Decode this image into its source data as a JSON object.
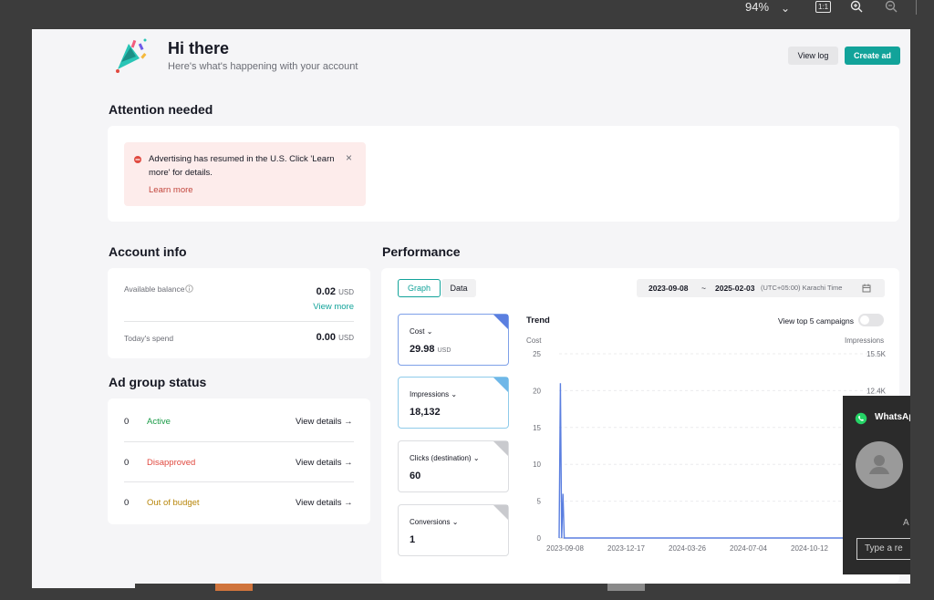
{
  "viewer": {
    "zoom": "94%",
    "icons": [
      "chevron-down-icon",
      "actual-size-icon",
      "zoom-in-icon",
      "zoom-out-icon"
    ],
    "actual_size_label": "1:1"
  },
  "header": {
    "title": "Hi there",
    "subtitle": "Here's what's happening with your account",
    "view_log": "View log",
    "create_ad": "Create ad"
  },
  "attention": {
    "heading": "Attention needed",
    "message": "Advertising has resumed in the U.S. Click 'Learn more' for details.",
    "link": "Learn more"
  },
  "account": {
    "heading": "Account info",
    "balance_label": "Available balance",
    "balance_value": "0.02",
    "balance_unit": "USD",
    "view_more": "View more",
    "spend_label": "Today's spend",
    "spend_value": "0.00",
    "spend_unit": "USD"
  },
  "ad_group": {
    "heading": "Ad group status",
    "rows": [
      {
        "count": "0",
        "status": "Active",
        "action": "View details",
        "color": "#1a9b47"
      },
      {
        "count": "0",
        "status": "Disapproved",
        "action": "View details",
        "color": "#e0493f"
      },
      {
        "count": "0",
        "status": "Out of budget",
        "action": "View details",
        "color": "#b8860b"
      }
    ]
  },
  "performance": {
    "heading": "Performance",
    "tabs": [
      "Graph",
      "Data"
    ],
    "date_start": "2023-09-08",
    "date_sep": "~",
    "date_end": "2025-02-03",
    "timezone": "(UTC+05:00) Karachi Time",
    "trend_label": "Trend",
    "top5_label": "View top 5 campaigns",
    "metrics": [
      {
        "label": "Cost",
        "value": "29.98",
        "unit": "USD",
        "selected": true,
        "corner": "#5b7fe0"
      },
      {
        "label": "Impressions",
        "value": "18,132",
        "unit": "",
        "selected": true,
        "corner": "#6fb7e8"
      },
      {
        "label": "Clicks (destination)",
        "value": "60",
        "unit": "",
        "selected": false,
        "corner": "#c9cace"
      },
      {
        "label": "Conversions",
        "value": "1",
        "unit": "",
        "selected": false,
        "corner": "#c9cace"
      }
    ]
  },
  "chart_data": {
    "type": "line",
    "left_axis_label": "Cost",
    "right_axis_label": "Impressions",
    "ylim_left": [
      0,
      25
    ],
    "yticks_left": [
      "25",
      "20",
      "15",
      "10",
      "5",
      "0"
    ],
    "yticks_right_visible": [
      "15.5K",
      "12.4K"
    ],
    "x_ticks": [
      "2023-09-08",
      "2023-12-17",
      "2024-03-26",
      "2024-07-04",
      "2024-10-12"
    ],
    "series": [
      {
        "name": "Cost",
        "color": "#5b7fe0",
        "x": [
          "2023-09-08",
          "2023-09-10",
          "2023-09-12",
          "2023-09-14",
          "2023-09-16",
          "2023-09-18",
          "2023-09-20",
          "2025-02-03"
        ],
        "values": [
          0,
          21,
          0,
          6,
          0,
          0,
          0,
          0
        ]
      }
    ]
  },
  "whatsapp": {
    "title": "WhatsApp",
    "input_placeholder": "Type a re"
  }
}
